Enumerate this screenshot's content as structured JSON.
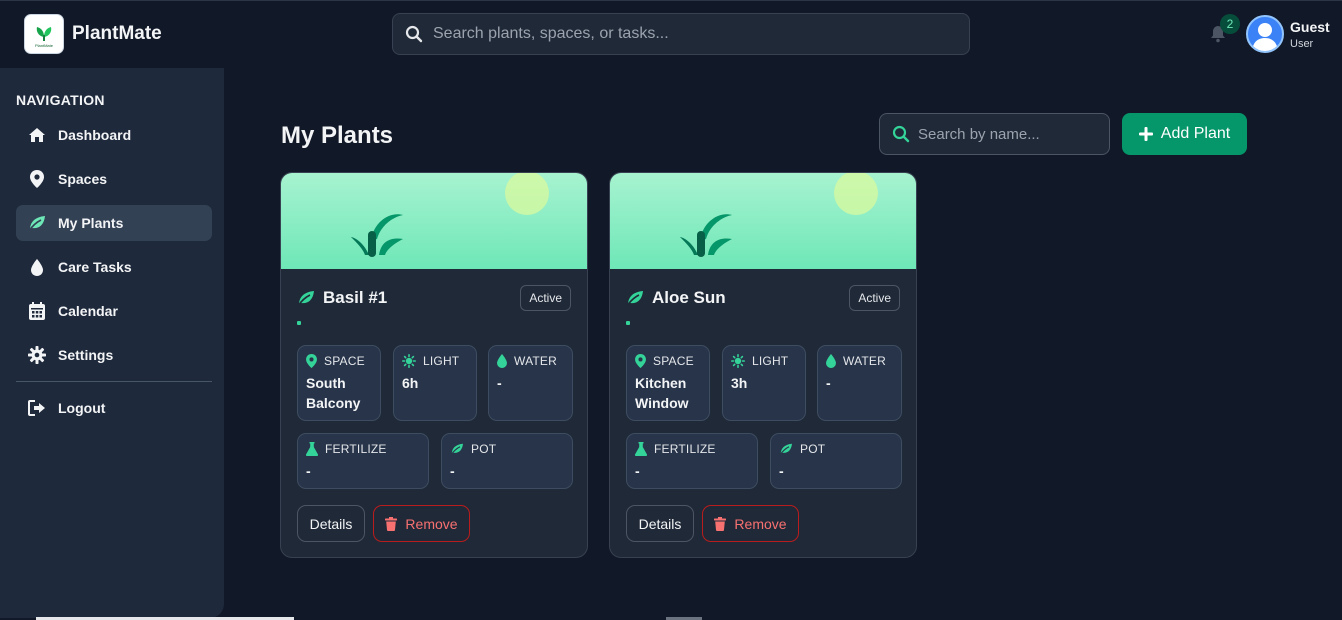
{
  "app": {
    "brand": "PlantMate",
    "logo_text": "PlantMate",
    "search_placeholder": "Search plants, spaces, or tasks...",
    "notifications_count": "2",
    "user_name": "Guest",
    "user_role": "User"
  },
  "sidebar": {
    "heading": "NAVIGATION",
    "items": [
      {
        "label": "Dashboard",
        "icon": "home-icon"
      },
      {
        "label": "Spaces",
        "icon": "map-pin-icon"
      },
      {
        "label": "My Plants",
        "icon": "leaf-icon",
        "active": true
      },
      {
        "label": "Care Tasks",
        "icon": "water-drop-icon"
      },
      {
        "label": "Calendar",
        "icon": "calendar-icon"
      },
      {
        "label": "Settings",
        "icon": "gear-icon"
      }
    ],
    "logout_label": "Logout"
  },
  "main": {
    "title": "My Plants",
    "search_placeholder": "Search by name...",
    "add_button": "Add Plant",
    "labels": {
      "space": "SPACE",
      "light": "LIGHT",
      "water": "WATER",
      "fertilize": "FERTILIZE",
      "pot": "POT",
      "details": "Details",
      "remove": "Remove"
    },
    "plants": [
      {
        "name": "Basil #1",
        "status": "Active",
        "space_line1": "South",
        "space_line2": "Balcony",
        "light": "6h",
        "water": "-",
        "fertilize": "-",
        "pot": "-"
      },
      {
        "name": "Aloe Sun",
        "status": "Active",
        "space_line1": "Kitchen",
        "space_line2": "Window",
        "light": "3h",
        "water": "-",
        "fertilize": "-",
        "pot": "-"
      }
    ]
  },
  "colors": {
    "accent": "#059669",
    "mint": "#6ee7b7",
    "danger": "#f87171",
    "background": "#111827",
    "sidebar": "#1e293b"
  }
}
